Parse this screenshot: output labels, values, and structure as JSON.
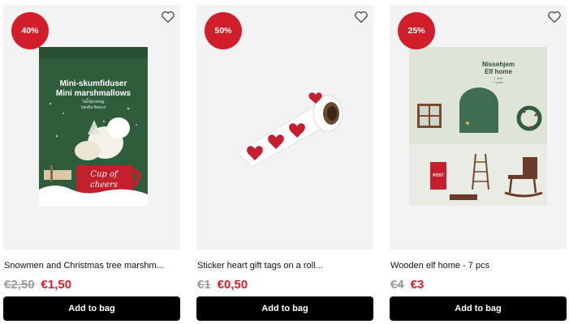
{
  "products": [
    {
      "badge": "40%",
      "title": "Snowmen and Christmas tree marshm...",
      "old_price": "€2,50",
      "new_price": "€1,50",
      "add_label": "Add to bag",
      "image": "marshmallow-bag",
      "package_title_1": "Mini-skumfiduser",
      "package_title_2": "Mini marshmallows",
      "package_sub_1": "Vaniljesmag",
      "package_sub_2": "Vanilla flavour",
      "cup_text_1": "Cup of",
      "cup_text_2": "cheers"
    },
    {
      "badge": "50%",
      "title": "Sticker heart gift tags on a roll...",
      "old_price": "€1",
      "new_price": "€0,50",
      "add_label": "Add to bag",
      "image": "heart-sticker-roll"
    },
    {
      "badge": "25%",
      "title": "Wooden elf home - 7 pcs",
      "old_price": "€4",
      "new_price": "€3",
      "add_label": "Add to bag",
      "image": "elf-home-box",
      "box_title_1": "Nissehjem",
      "box_title_2": "Elf home",
      "box_sub_1": "7 dele",
      "box_sub_2": "7 parts",
      "post_label": "POST"
    }
  ],
  "colors": {
    "accent_red": "#d21e2b",
    "button_black": "#000000",
    "tile_bg": "#f3f3f3"
  }
}
